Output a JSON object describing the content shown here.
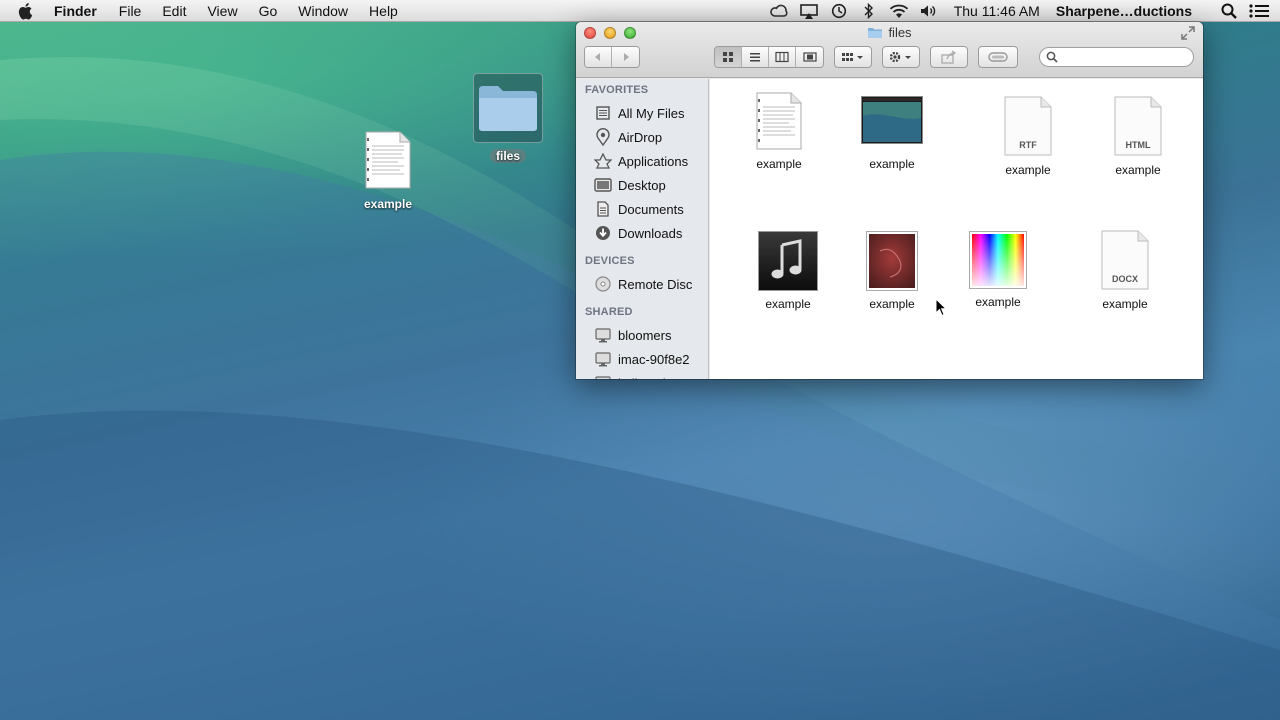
{
  "menubar": {
    "app_name": "Finder",
    "items": [
      "File",
      "Edit",
      "View",
      "Go",
      "Window",
      "Help"
    ],
    "clock": "Thu 11:46 AM",
    "user": "Sharpene…ductions",
    "status_icons": [
      "creative-cloud-icon",
      "airplay-icon",
      "time-machine-icon",
      "bluetooth-icon",
      "wifi-icon",
      "volume-icon",
      "spotlight-icon",
      "notification-center-icon"
    ]
  },
  "desktop": {
    "icons": [
      {
        "label": "example",
        "kind": "text-document"
      },
      {
        "label": "files",
        "kind": "folder"
      }
    ]
  },
  "window": {
    "title": "files",
    "search": {
      "placeholder": "",
      "value": ""
    }
  },
  "sidebar": {
    "favorites_header": "FAVORITES",
    "favorites": [
      {
        "label": "All My Files",
        "icon": "all-files-icon"
      },
      {
        "label": "AirDrop",
        "icon": "airdrop-icon"
      },
      {
        "label": "Applications",
        "icon": "applications-icon"
      },
      {
        "label": "Desktop",
        "icon": "desktop-icon"
      },
      {
        "label": "Documents",
        "icon": "documents-icon"
      },
      {
        "label": "Downloads",
        "icon": "downloads-icon"
      }
    ],
    "devices_header": "DEVICES",
    "devices": [
      {
        "label": "Remote Disc",
        "icon": "disc-icon"
      }
    ],
    "shared_header": "SHARED",
    "shared": [
      {
        "label": "bloomers",
        "icon": "computer-icon"
      },
      {
        "label": "imac-90f8e2",
        "icon": "computer-icon"
      },
      {
        "label": "kellens-imac",
        "icon": "computer-icon"
      }
    ]
  },
  "files": [
    {
      "name": "example",
      "type": "text-document"
    },
    {
      "name": "example",
      "type": "image-screenshot"
    },
    {
      "name": "example",
      "type": "rtf",
      "badge": "RTF"
    },
    {
      "name": "example",
      "type": "html",
      "badge": "HTML"
    },
    {
      "name": "example",
      "type": "audio"
    },
    {
      "name": "example",
      "type": "image-photo"
    },
    {
      "name": "example",
      "type": "image-gradient"
    },
    {
      "name": "example",
      "type": "docx",
      "badge": "DOCX"
    }
  ]
}
